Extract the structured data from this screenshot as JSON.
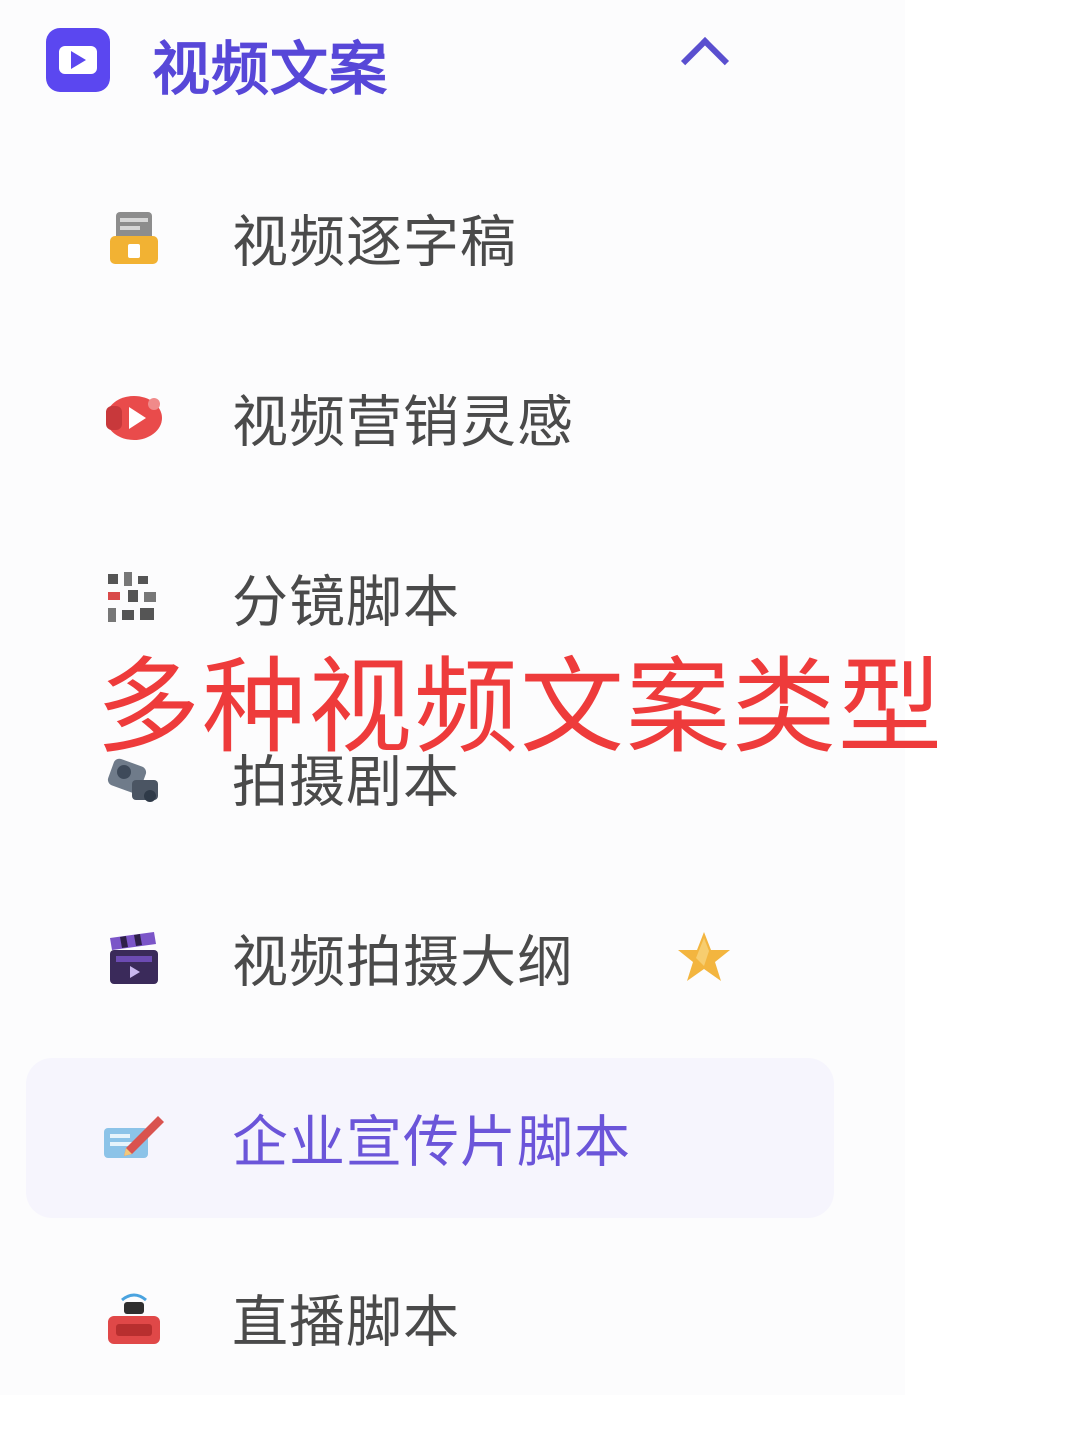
{
  "group": {
    "title": "视频文案",
    "icon": "video-text-icon",
    "expanded": true,
    "accent_color": "#5b47f0"
  },
  "items": [
    {
      "label": "视频逐字稿",
      "icon": "transcript-icon"
    },
    {
      "label": "视频营销灵感",
      "icon": "play-inspiration-icon"
    },
    {
      "label": "分镜脚本",
      "icon": "storyboard-icon"
    },
    {
      "label": "拍摄剧本",
      "icon": "camera-icon"
    },
    {
      "label": "视频拍摄大纲",
      "icon": "clapperboard-icon",
      "badge": "star-icon"
    },
    {
      "label": "企业宣传片脚本",
      "icon": "edit-pen-icon",
      "active": true
    },
    {
      "label": "直播脚本",
      "icon": "live-icon"
    }
  ],
  "overlay": {
    "caption": "多种视频文案类型",
    "color": "#ee3b3b"
  }
}
